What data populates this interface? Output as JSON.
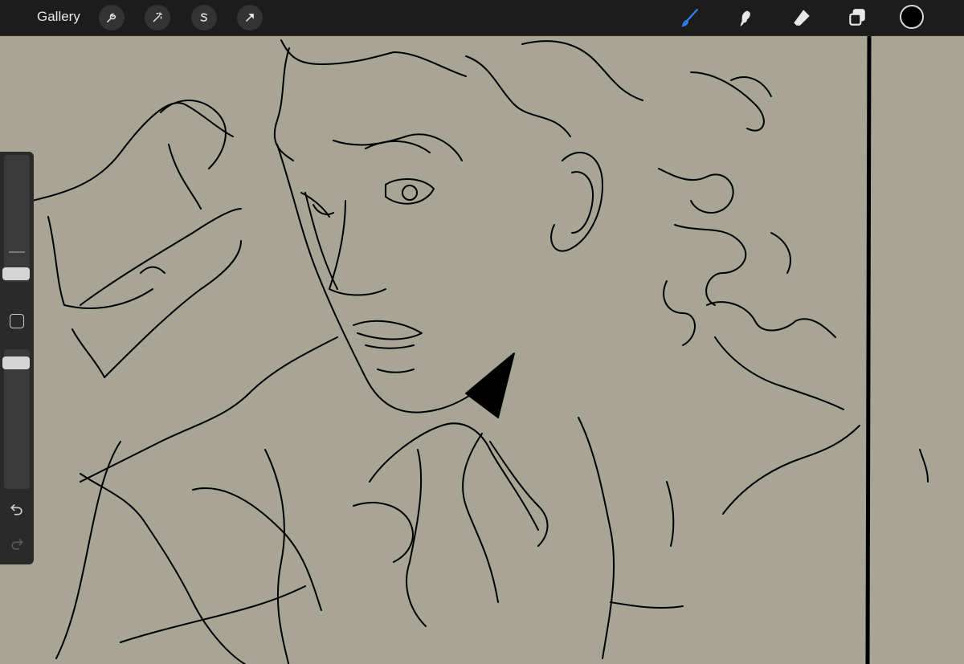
{
  "app": {
    "toolbar": {
      "gallery_label": "Gallery",
      "left_tools": [
        {
          "icon": "wrench-icon",
          "name": "actions"
        },
        {
          "icon": "magic-wand-icon",
          "name": "adjustments"
        },
        {
          "icon": "selection-s-icon",
          "name": "selection"
        },
        {
          "icon": "transform-arrow-icon",
          "name": "transform"
        }
      ],
      "right_tools": [
        {
          "icon": "brush-icon",
          "name": "brush",
          "active": true
        },
        {
          "icon": "smudge-icon",
          "name": "smudge"
        },
        {
          "icon": "eraser-icon",
          "name": "eraser"
        },
        {
          "icon": "layers-icon",
          "name": "layers"
        }
      ],
      "current_color": "#000000",
      "active_color": "#2f7ff5"
    },
    "sidebar": {
      "brush_size_level": 0.6,
      "opacity_level": 0.95,
      "modify_icon": "square-icon",
      "undo_icon": "undo-icon",
      "redo_icon": "redo-icon"
    },
    "canvas": {
      "background": "#a8a496",
      "content": "line-art-sketch"
    }
  }
}
